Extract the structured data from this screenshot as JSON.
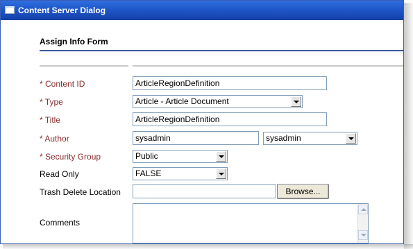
{
  "window": {
    "title": "Content Server Dialog",
    "icon": "window-icon"
  },
  "form": {
    "title": "Assign Info Form",
    "fields": {
      "content_id": {
        "label": "* Content ID",
        "value": "ArticleRegionDefinition"
      },
      "type": {
        "label": "* Type",
        "value": "Article - Article Document"
      },
      "title": {
        "label": "* Title",
        "value": "ArticleRegionDefinition"
      },
      "author": {
        "label": "* Author",
        "value": "sysadmin",
        "select_value": "sysadmin"
      },
      "security_group": {
        "label": "* Security Group",
        "value": "Public"
      },
      "read_only": {
        "label": "Read Only",
        "value": "FALSE"
      },
      "trash_delete_location": {
        "label": "Trash Delete Location",
        "value": "",
        "button_label": "Browse..."
      },
      "comments": {
        "label": "Comments",
        "value": ""
      }
    }
  },
  "colors": {
    "title_bar": "#1f57c9",
    "required_label": "#8b2a2a",
    "field_border": "#7f9db9",
    "rule": "#3a5a9a"
  }
}
